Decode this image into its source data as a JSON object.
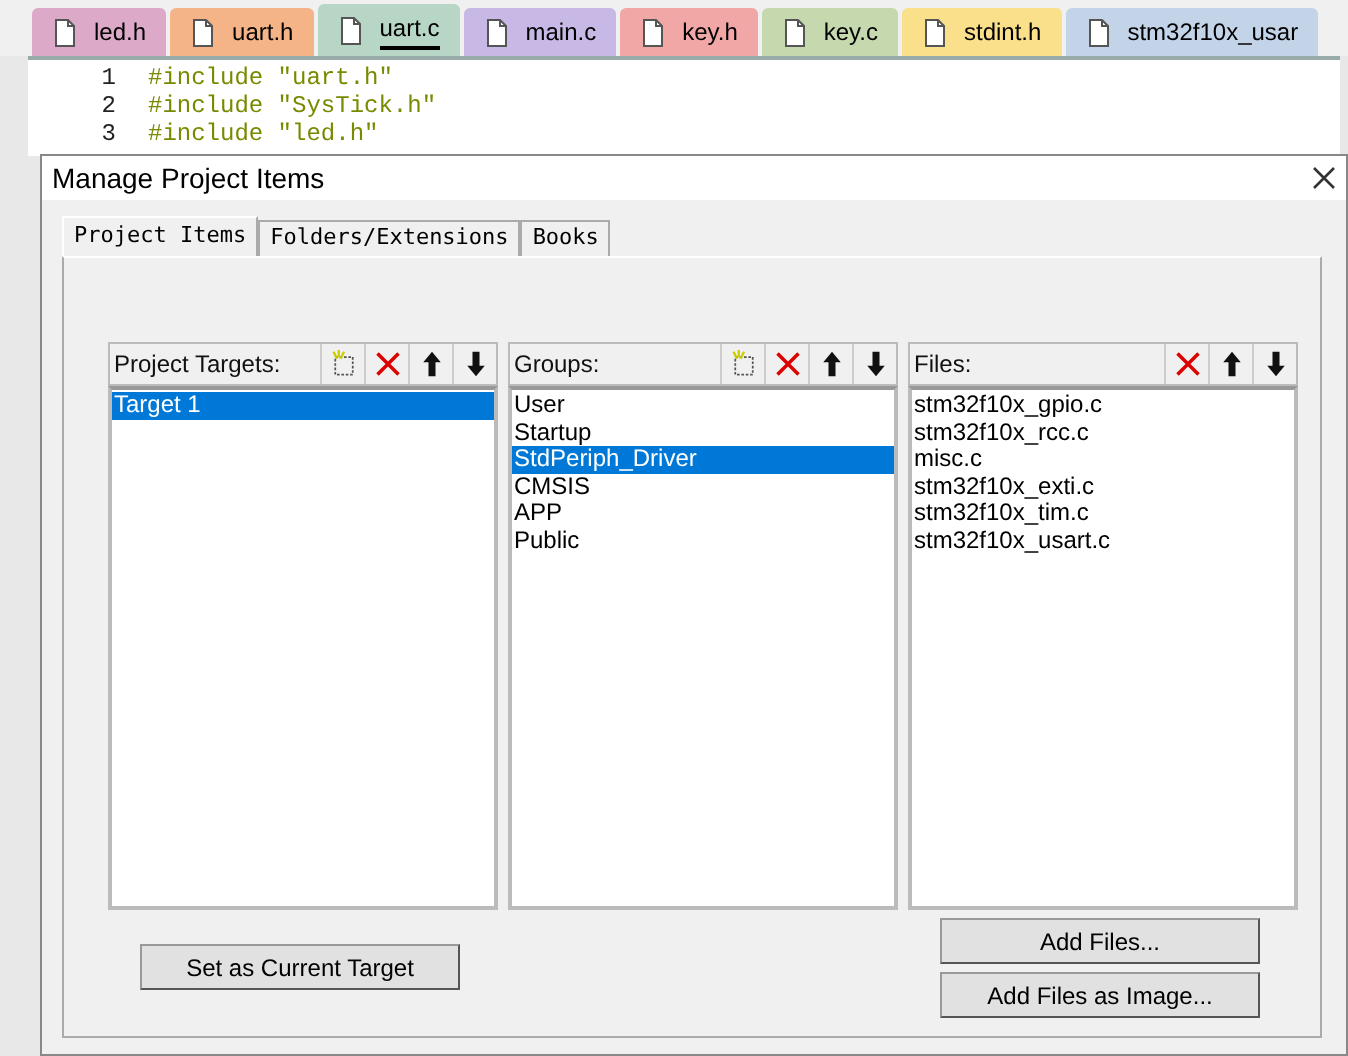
{
  "editor_tabs": [
    {
      "label": "led.h",
      "color": "#dcaac8",
      "selected": false
    },
    {
      "label": "uart.h",
      "color": "#f5b487",
      "selected": false
    },
    {
      "label": "uart.c",
      "color": "#b8d6c6",
      "selected": true
    },
    {
      "label": "main.c",
      "color": "#c8b8e6",
      "selected": false
    },
    {
      "label": "key.h",
      "color": "#f2a7a7",
      "selected": false
    },
    {
      "label": "key.c",
      "color": "#c6d9ae",
      "selected": false
    },
    {
      "label": "stdint.h",
      "color": "#fbe08c",
      "selected": false
    },
    {
      "label": "stm32f10x_usar",
      "color": "#c4d4e8",
      "selected": false
    }
  ],
  "code_lines": [
    {
      "number": "1",
      "text": "#include \"uart.h\""
    },
    {
      "number": "2",
      "text": "#include \"SysTick.h\""
    },
    {
      "number": "3",
      "text": "#include \"led.h\""
    }
  ],
  "dialog": {
    "title": "Manage Project Items",
    "tabs": [
      {
        "label": "Project Items",
        "selected": true
      },
      {
        "label": "Folders/Extensions",
        "selected": false
      },
      {
        "label": "Books",
        "selected": false
      }
    ],
    "panels": [
      {
        "title": "Project Targets:",
        "buttons": [
          {
            "kind": "new"
          },
          {
            "kind": "delete"
          },
          {
            "kind": "up"
          },
          {
            "kind": "down"
          }
        ],
        "items": [
          {
            "label": "Target 1",
            "selected": true
          }
        ]
      },
      {
        "title": "Groups:",
        "buttons": [
          {
            "kind": "new"
          },
          {
            "kind": "delete"
          },
          {
            "kind": "up"
          },
          {
            "kind": "down"
          }
        ],
        "items": [
          {
            "label": "User",
            "selected": false
          },
          {
            "label": "Startup",
            "selected": false
          },
          {
            "label": "StdPeriph_Driver",
            "selected": true
          },
          {
            "label": "CMSIS",
            "selected": false
          },
          {
            "label": "APP",
            "selected": false
          },
          {
            "label": "Public",
            "selected": false
          }
        ]
      },
      {
        "title": "Files:",
        "buttons": [
          {
            "kind": "delete"
          },
          {
            "kind": "up"
          },
          {
            "kind": "down"
          }
        ],
        "items": [
          {
            "label": "stm32f10x_gpio.c",
            "selected": false
          },
          {
            "label": "stm32f10x_rcc.c",
            "selected": false
          },
          {
            "label": "misc.c",
            "selected": false
          },
          {
            "label": "stm32f10x_exti.c",
            "selected": false
          },
          {
            "label": "stm32f10x_tim.c",
            "selected": false
          },
          {
            "label": "stm32f10x_usart.c",
            "selected": false
          }
        ]
      }
    ],
    "set_target_button": "Set as Current Target",
    "add_files_button": "Add Files...",
    "add_image_button": "Add Files as Image..."
  }
}
